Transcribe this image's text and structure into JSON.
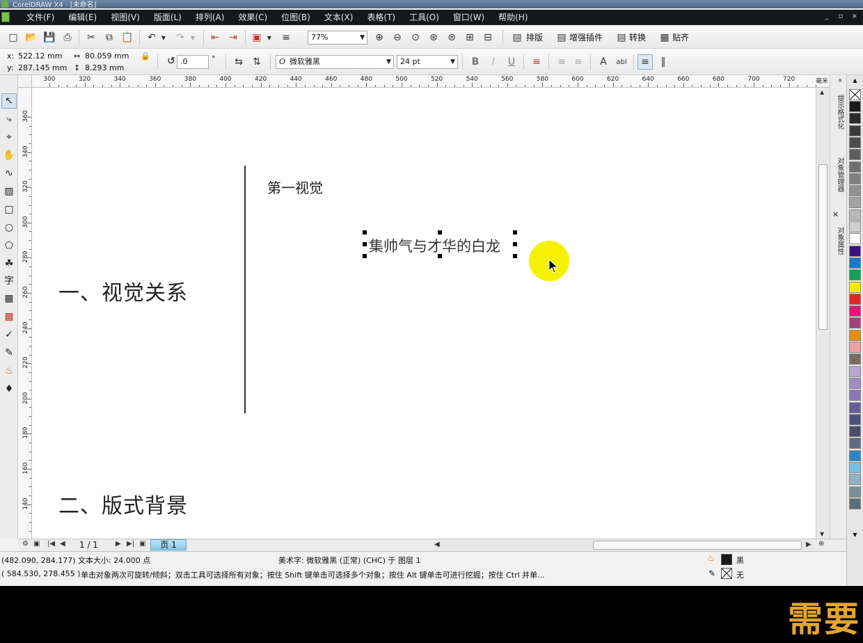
{
  "window": {
    "title": "CorelDRAW X4 - [未命名]"
  },
  "menu": [
    "文件(F)",
    "编辑(E)",
    "视图(V)",
    "版面(L)",
    "排列(A)",
    "效果(C)",
    "位图(B)",
    "文本(X)",
    "表格(T)",
    "工具(O)",
    "窗口(W)",
    "帮助(H)"
  ],
  "window_controls": {
    "minimize": "_",
    "restore": "▫",
    "close": "×"
  },
  "toolbar1": {
    "zoom": "77%",
    "plugin_buttons": [
      "排版",
      "增强插件",
      "转换",
      "贴齐"
    ]
  },
  "props": {
    "x": "522.12 mm",
    "y": "287.145 mm",
    "width": "80.059 mm",
    "height": "8.293 mm",
    "x_label": "x:",
    "y_label": "y:",
    "rotation": ".0",
    "degree": "°",
    "font": "微软雅黑",
    "font_glyph": "O",
    "font_size": "24 pt"
  },
  "ruler_top": [
    "300",
    "320",
    "340",
    "360",
    "380",
    "400",
    "420",
    "440",
    "460",
    "480",
    "500",
    "520",
    "540",
    "560",
    "580",
    "600",
    "620",
    "640",
    "660",
    "680",
    "700",
    "720"
  ],
  "ruler_unit": "毫米",
  "ruler_left": [
    "360",
    "340",
    "320",
    "300",
    "280",
    "260",
    "240",
    "220",
    "200",
    "180",
    "160",
    "140"
  ],
  "canvas": {
    "heading1": "一、视觉关系",
    "heading2": "二、版式背景",
    "label_first": "第一视觉",
    "selected_text": "集帅气与才华的白龙"
  },
  "docker_tabs": [
    "提示格式化",
    "对象管理器",
    "对象属性"
  ],
  "palette_colors": [
    "#1a1a1a",
    "#2b2b2b",
    "#3c3c3c",
    "#4d4d4d",
    "#5e5e5e",
    "#6f6f6f",
    "#808080",
    "#919191",
    "#a2a2a2",
    "#b9b9b9",
    "#d0d0d0",
    "#ffffff",
    "#3a1180",
    "#1d78c8",
    "#14a05a",
    "#f6ea00",
    "#e6261f",
    "#e0157a",
    "#a1417a",
    "#e78b13",
    "#f0a1a1",
    "#7a6b61",
    "#b7a6cf",
    "#9e8bc0",
    "#8a76b2",
    "#6a5e99",
    "#4f4f7d",
    "#4a4e66",
    "#5d6b86",
    "#2f84c6",
    "#78bfe8",
    "#8fb3c2",
    "#7a8f99",
    "#5a6f7a"
  ],
  "pagebar": {
    "count": "1 / 1",
    "page_tab": "页 1"
  },
  "status": {
    "line1_left": "(482.090, 284.177)  文本大小: 24.000 点",
    "line1_mid": "美术字: 微软雅黑 (正常) (CHC) 于 图层 1",
    "line2_left": "( 584.530, 278.455 )",
    "line2_mid": "单击对象两次可旋转/倾斜；双击工具可选择所有对象；按住 Shift 键单击可选择多个对象；按住 Alt 键单击可进行挖掘；按住 Ctrl 并单...",
    "fill_name": "黑",
    "outline_name": "无",
    "fill_color": "#1a1a1a"
  },
  "overlay_text": "需要"
}
